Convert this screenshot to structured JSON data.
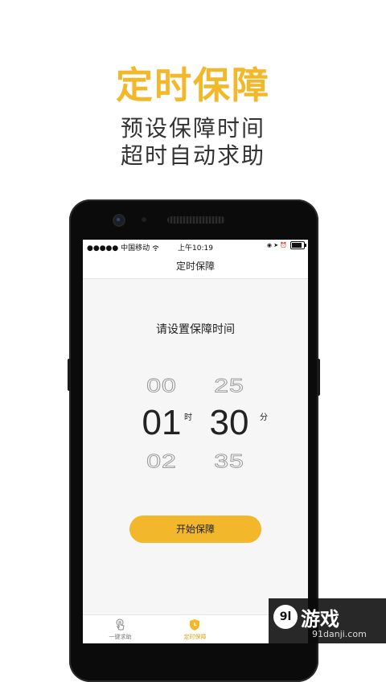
{
  "promo": {
    "title": "定时保障",
    "line1": "预设保障时间",
    "line2": "超时自动求助"
  },
  "status_bar": {
    "carrier": "●●●●● 中国移动",
    "time": "上午10:19",
    "right_glyphs": "◉ ➤ ⏰"
  },
  "screen": {
    "nav_title": "定时保障",
    "prompt": "请设置保障时间",
    "picker": {
      "hours": {
        "prev": "00",
        "current": "01",
        "next": "02",
        "unit": "时"
      },
      "minutes": {
        "prev": "25",
        "current": "30",
        "next": "35",
        "unit": "分"
      }
    },
    "start_button": "开始保障",
    "tabs": [
      {
        "label": "一键求助",
        "icon": "tap-hand-icon",
        "active": false
      },
      {
        "label": "定时保障",
        "icon": "shield-clock-icon",
        "active": true
      }
    ]
  },
  "watermark": {
    "logo": "9l",
    "name": "游戏",
    "url": "91danji.com"
  },
  "colors": {
    "accent": "#f2b72b",
    "title": "#f3b72a"
  }
}
